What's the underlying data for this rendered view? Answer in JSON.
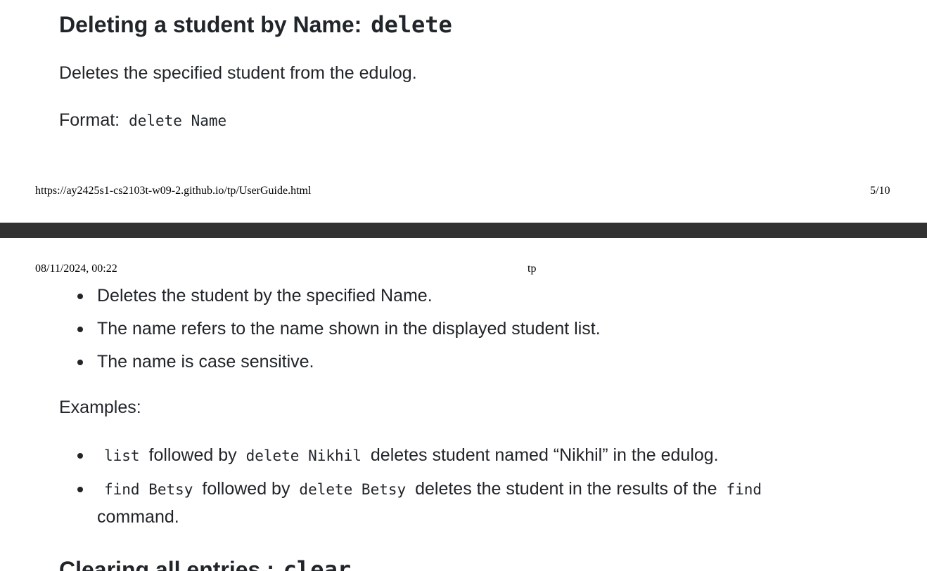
{
  "section_delete": {
    "heading_text": "Deleting a student by Name:",
    "heading_command": "delete",
    "description": "Deletes the specified student from the edulog.",
    "format_label": "Format:",
    "format_code": "delete Name"
  },
  "print_footer": {
    "url": "https://ay2425s1-cs2103t-w09-2.github.io/tp/UserGuide.html",
    "page": "5/10"
  },
  "print_header": {
    "datetime": "08/11/2024, 00:22",
    "title": "tp"
  },
  "notes": [
    "Deletes the student by the specified Name.",
    "The name refers to the name shown in the displayed student list.",
    "The name is case sensitive."
  ],
  "examples_label": "Examples:",
  "examples": {
    "ex1": {
      "code1": "list",
      "text1": "followed by",
      "code2": "delete Nikhil",
      "text2": "deletes student named “Nikhil” in the edulog."
    },
    "ex2": {
      "code1": "find Betsy",
      "text1": "followed by",
      "code2": "delete Betsy",
      "text2": "deletes the student in the results of the",
      "code3": "find",
      "text3": "command."
    }
  },
  "section_clear": {
    "heading_text": "Clearing all entries :",
    "heading_command": "clear"
  }
}
